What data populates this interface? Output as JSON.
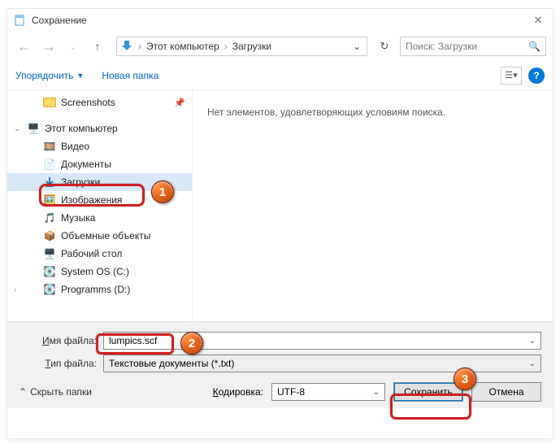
{
  "window": {
    "title": "Сохранение"
  },
  "nav": {
    "path_root": "Этот компьютер",
    "path_current": "Загрузки",
    "search_placeholder": "Поиск: Загрузки"
  },
  "toolbar": {
    "organize": "Упорядочить",
    "new_folder": "Новая папка"
  },
  "tree": {
    "screenshots": "Screenshots",
    "this_pc": "Этот компьютер",
    "video": "Видео",
    "documents": "Документы",
    "downloads": "Загрузки",
    "pictures": "Изображения",
    "music": "Музыка",
    "objects3d": "Объемные объекты",
    "desktop": "Рабочий стол",
    "system_os": "System OS (C:)",
    "programms": "Programms (D:)"
  },
  "content": {
    "empty": "Нет элементов, удовлетворяющих условиям поиска."
  },
  "form": {
    "filename_label": "Имя файла:",
    "filename_value": "lumpics.scf",
    "filetype_label": "Тип файла:",
    "filetype_value": "Текстовые документы (*.txt)",
    "hide_folders": "Скрыть папки",
    "encoding_label": "Кодировка:",
    "encoding_value": "UTF-8",
    "save": "Сохранить",
    "cancel": "Отмена"
  },
  "callouts": {
    "c1": "1",
    "c2": "2",
    "c3": "3"
  }
}
